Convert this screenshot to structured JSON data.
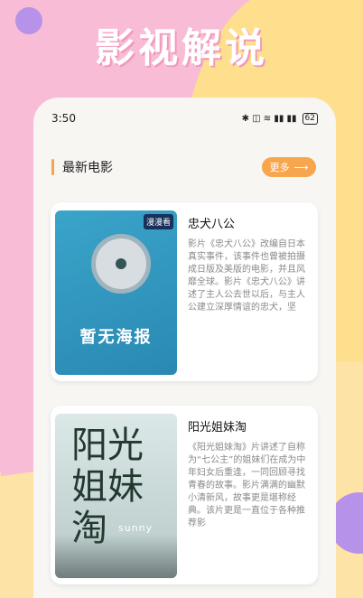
{
  "header": {
    "title": "影视解说"
  },
  "status_bar": {
    "time": "3:50",
    "icons": "✱ ◫ ≋ ▮▮ ▮▮",
    "battery": "62"
  },
  "section": {
    "title": "最新电影",
    "more_label": "更多"
  },
  "movies": [
    {
      "poster_badge": "漫漫看",
      "poster_text": "暂无海报",
      "title": "忠犬八公",
      "description": "影片《忠犬八公》改编自日本真实事件，该事件也曾被拍摄成日版及美版的电影，并且风靡全球。影片《忠犬八公》讲述了主人公去世以后，与主人公建立深厚情谊的忠犬，坚"
    },
    {
      "poster_text": "阳光姐妹淘",
      "poster_sub": "sunny",
      "title": "阳光姐妹淘",
      "description": "《阳光姐妹淘》片讲述了自称为“七公主”的姐妹们在成为中年妇女后重逢，一同回顾寻找青春的故事。影片满满的幽默小清新风，故事更是堪称经典。该片更是一直位于各种推荐影"
    }
  ],
  "colors": {
    "accent": "#f7a64d",
    "pink_bg": "#f8bcd7",
    "yellow_bg": "#fddf8d",
    "purple_dot": "#b693e8"
  }
}
